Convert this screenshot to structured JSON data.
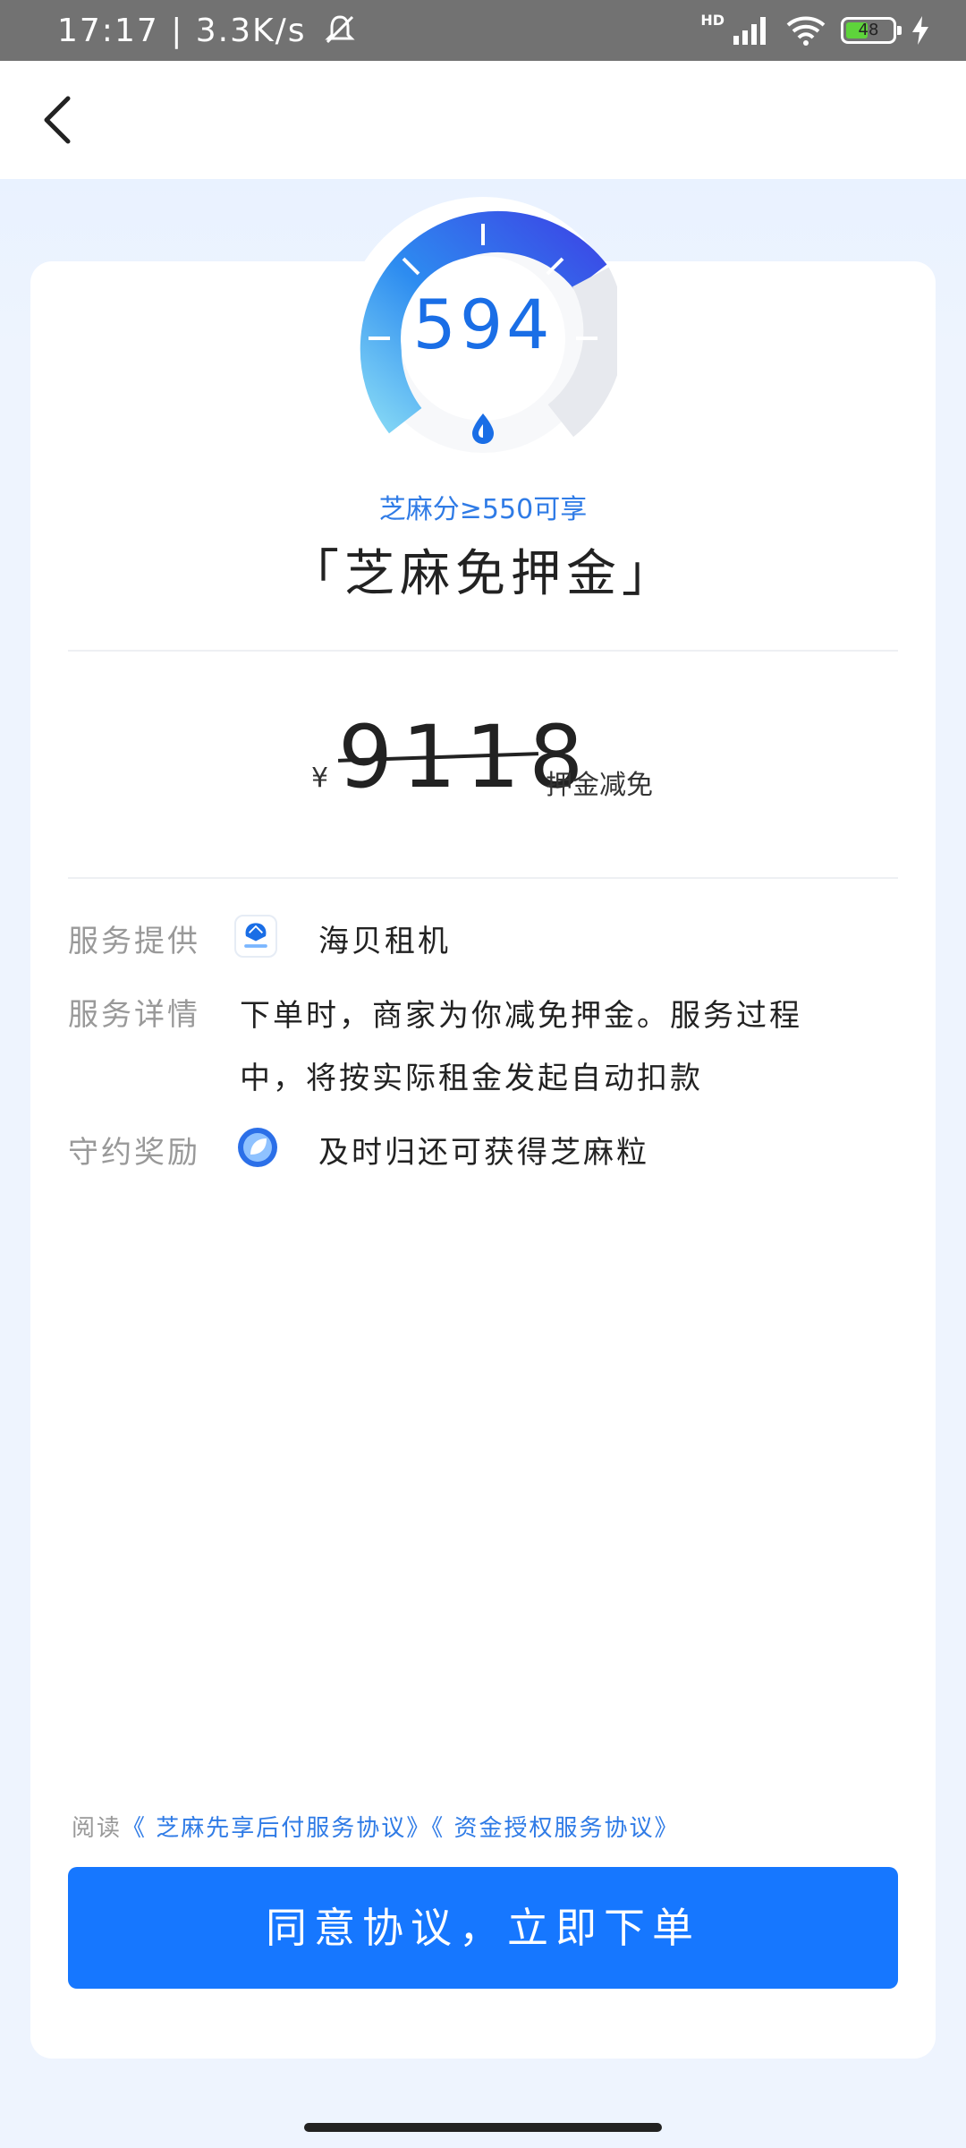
{
  "status_bar": {
    "time": "17:17",
    "network_speed": "3.3K/s",
    "hd_label": "HD",
    "battery_level": "48"
  },
  "credit": {
    "score": "594",
    "eligibility_text": "芝麻分≥550可享",
    "title": "「芝麻免押金」"
  },
  "deposit": {
    "currency": "¥",
    "amount": "9118",
    "note": "押金减免"
  },
  "info": {
    "provider_label": "服务提供",
    "provider_name": "海贝租机",
    "detail_label": "服务详情",
    "detail_text": "下单时，商家为你减免押金。服务过程中，将按实际租金发起自动扣款",
    "reward_label": "守约奖励",
    "reward_text": "及时归还可获得芝麻粒"
  },
  "agreement": {
    "prefix": "阅读",
    "link1": "《 芝麻先享后付服务协议》",
    "link2": "《 资金授权服务协议》"
  },
  "submit_label": "同意协议，立即下单",
  "colors": {
    "accent": "#1677ff",
    "gauge_blue": "#1a6ee6",
    "page_bg": "#eef4fe"
  }
}
